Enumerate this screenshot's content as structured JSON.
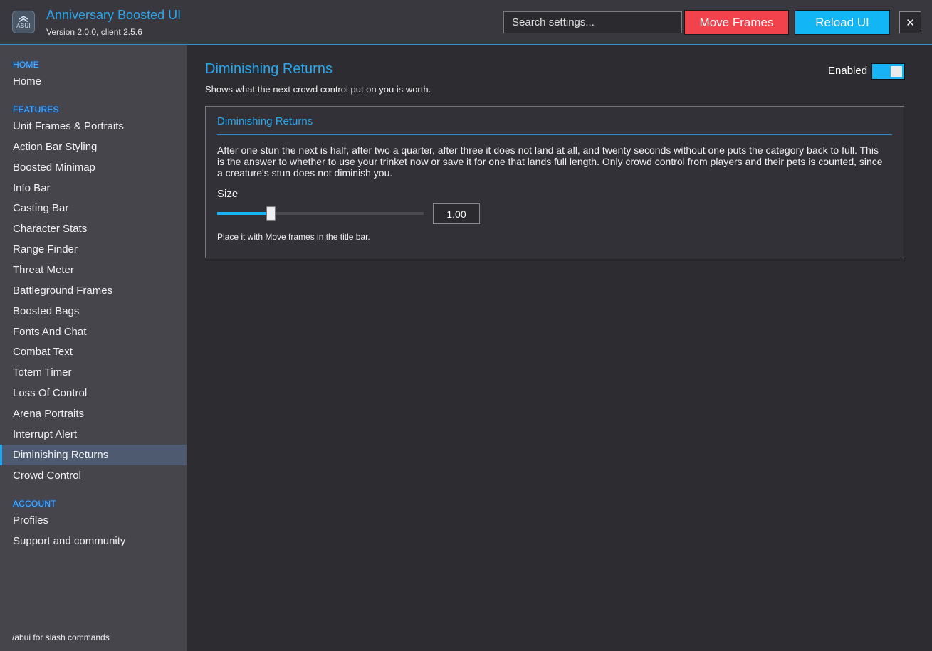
{
  "app": {
    "logo_text": "ABUI",
    "title": "Anniversary Boosted UI",
    "version": "Version 2.0.0, client 2.5.6"
  },
  "header": {
    "search_placeholder": "Search settings...",
    "move_frames_label": "Move Frames",
    "reload_ui_label": "Reload UI",
    "close_label": "✕",
    "colors": {
      "move_frames": "#f2434c",
      "reload_ui": "#12b6f5",
      "accent": "#2aa7ee"
    }
  },
  "sidebar": {
    "sections": [
      {
        "heading": "HOME",
        "items": [
          "Home"
        ]
      },
      {
        "heading": "FEATURES",
        "items": [
          "Unit Frames & Portraits",
          "Action Bar Styling",
          "Boosted Minimap",
          "Info Bar",
          "Casting Bar",
          "Character Stats",
          "Range Finder",
          "Threat Meter",
          "Battleground Frames",
          "Boosted Bags",
          "Fonts And Chat",
          "Combat Text",
          "Totem Timer",
          "Loss Of Control",
          "Arena Portraits",
          "Interrupt Alert",
          "Diminishing Returns",
          "Crowd Control"
        ]
      },
      {
        "heading": "ACCOUNT",
        "items": [
          "Profiles",
          "Support and community"
        ]
      }
    ],
    "active_item": "Diminishing Returns",
    "footer": "/abui for slash commands"
  },
  "page": {
    "title": "Diminishing Returns",
    "subtitle": "Shows what the next crowd control put on you is worth.",
    "enabled_label": "Enabled",
    "enabled": true
  },
  "panel": {
    "title": "Diminishing Returns",
    "description": "After one stun the next is half, after two a quarter, after three it does not land at all, and twenty seconds without one puts the category back to full. This is the answer to whether to use your trinket now or save it for one that lands full length.  Only crowd control from players and their pets is counted, since a creature's stun does not diminish you.",
    "size_label": "Size",
    "size_value": "1.00",
    "size_fraction": 0.26,
    "hint": "Place it with Move frames in the title bar."
  }
}
